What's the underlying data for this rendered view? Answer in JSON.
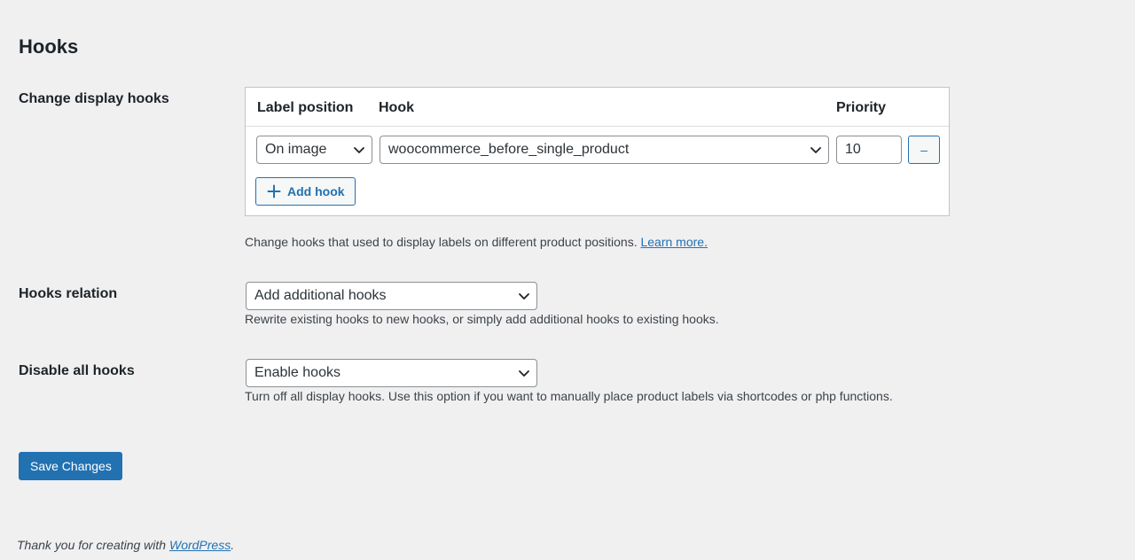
{
  "page": {
    "title": "Hooks"
  },
  "change_display_hooks": {
    "label": "Change display hooks",
    "columns": {
      "label_position": "Label position",
      "hook": "Hook",
      "priority": "Priority"
    },
    "rows": [
      {
        "label_position": "On image",
        "hook": "woocommerce_before_single_product",
        "priority": "10",
        "remove_label": "–"
      }
    ],
    "add_hook_label": "Add hook",
    "description": "Change hooks that used to display labels on different product positions.",
    "learn_more": "Learn more."
  },
  "hooks_relation": {
    "label": "Hooks relation",
    "selected": "Add additional hooks",
    "description": "Rewrite existing hooks to new hooks, or simply add additional hooks to existing hooks."
  },
  "disable_all_hooks": {
    "label": "Disable all hooks",
    "selected": "Enable hooks",
    "description": "Turn off all display hooks. Use this option if you want to manually place product labels via shortcodes or php functions."
  },
  "save_button": "Save Changes",
  "footer": {
    "text": "Thank you for creating with ",
    "link": "WordPress",
    "end": "."
  },
  "colors": {
    "accent": "#2271b1",
    "background": "#f0f0f1"
  },
  "icons": {
    "add": "plus-icon",
    "dropdown": "chevron-down-icon"
  }
}
